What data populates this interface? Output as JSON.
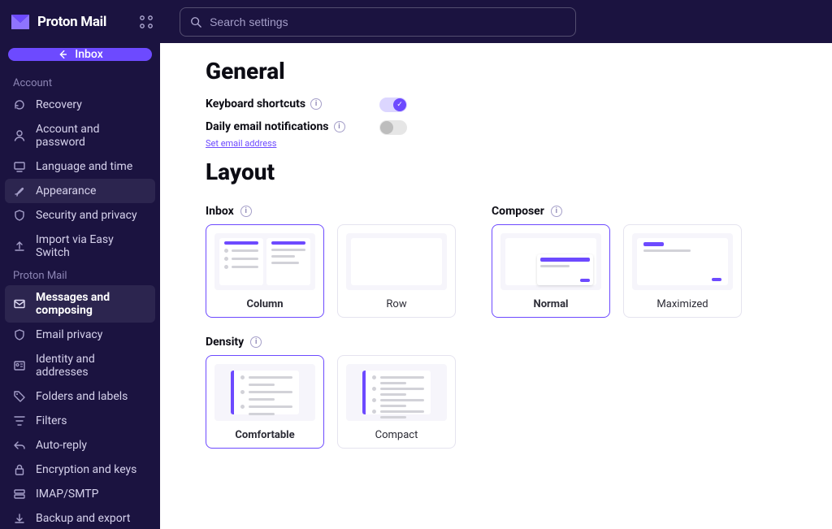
{
  "accent_color": "#6d4aff",
  "brand": {
    "name": "Proton Mail"
  },
  "topbar": {
    "inbox_label": "Inbox",
    "search_placeholder": "Search settings"
  },
  "sidebar": {
    "sections": [
      {
        "label": "Account",
        "items": [
          {
            "name": "Recovery",
            "icon": "arrow-rotate-icon"
          },
          {
            "name": "Account and password",
            "icon": "user-icon"
          },
          {
            "name": "Language and time",
            "icon": "monitor-icon"
          },
          {
            "name": "Appearance",
            "icon": "brush-icon",
            "hovered": true
          },
          {
            "name": "Security and privacy",
            "icon": "shield-icon"
          },
          {
            "name": "Import via Easy Switch",
            "icon": "upload-icon"
          }
        ]
      },
      {
        "label": "Proton Mail",
        "items": [
          {
            "name": "Messages and composing",
            "icon": "envelope-icon",
            "active": true
          },
          {
            "name": "Email privacy",
            "icon": "shield-icon"
          },
          {
            "name": "Identity and addresses",
            "icon": "id-card-icon"
          },
          {
            "name": "Folders and labels",
            "icon": "tag-icon"
          },
          {
            "name": "Filters",
            "icon": "filter-icon"
          },
          {
            "name": "Auto-reply",
            "icon": "reply-icon"
          },
          {
            "name": "Encryption and keys",
            "icon": "lock-icon"
          },
          {
            "name": "IMAP/SMTP",
            "icon": "server-icon"
          },
          {
            "name": "Backup and export",
            "icon": "export-icon"
          }
        ]
      }
    ]
  },
  "general": {
    "title": "General",
    "keyboard_shortcuts_label": "Keyboard shortcuts",
    "keyboard_shortcuts_enabled": true,
    "daily_email_notifications_label": "Daily email notifications",
    "daily_email_notifications_enabled": false,
    "set_email_address_link": "Set email address"
  },
  "layout": {
    "title": "Layout",
    "inbox_label": "Inbox",
    "inbox_options": [
      {
        "label": "Column",
        "selected": true
      },
      {
        "label": "Row",
        "selected": false
      }
    ],
    "composer_label": "Composer",
    "composer_options": [
      {
        "label": "Normal",
        "selected": true
      },
      {
        "label": "Maximized",
        "selected": false
      }
    ],
    "density_label": "Density",
    "density_options": [
      {
        "label": "Comfortable",
        "selected": true
      },
      {
        "label": "Compact",
        "selected": false
      }
    ]
  }
}
